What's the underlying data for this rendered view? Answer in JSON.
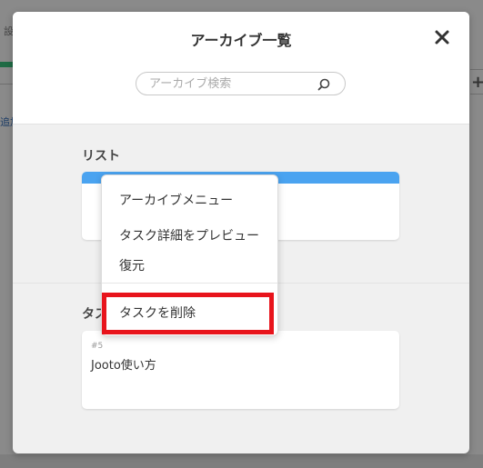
{
  "background": {
    "fragment_left_top": "設",
    "fragment_left_link": "追加",
    "fragment_right_plus": "+"
  },
  "modal": {
    "title": "アーカイブ一覧",
    "close_icon": "close-icon",
    "search": {
      "placeholder": "アーカイブ検索",
      "value": "",
      "icon": "search-icon"
    },
    "sections": {
      "list_label": "リスト",
      "task_label": "タス"
    },
    "task_card": {
      "id": "#5",
      "name": "Jooto使い方"
    }
  },
  "context_menu": {
    "title": "アーカイブメニュー",
    "items": [
      {
        "label": "タスク詳細をプレビュー"
      },
      {
        "label": "復元"
      },
      {
        "label": "タスクを削除"
      }
    ],
    "highlight_color": "#e8141c"
  },
  "colors": {
    "list_card_accent": "#4aa3f0",
    "modal_body": "#f0f0f0",
    "highlight": "#e8141c"
  }
}
